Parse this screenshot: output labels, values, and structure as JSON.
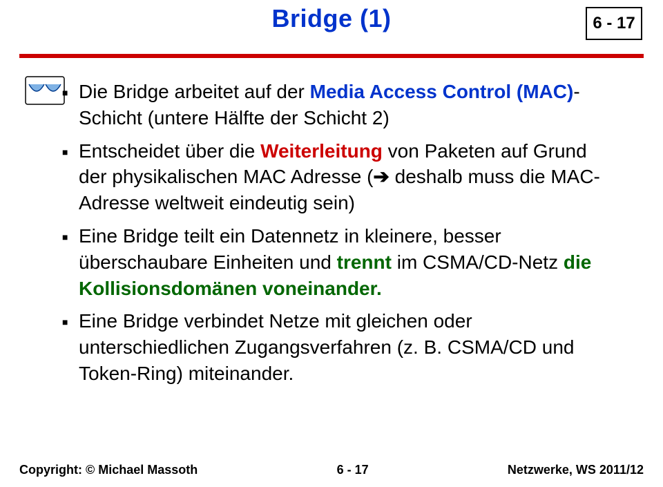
{
  "header": {
    "title": "Bridge (1)",
    "page_box": "6 - 17"
  },
  "bullets": {
    "b1": {
      "pre": "Die Bridge arbeitet auf der ",
      "em1": "Media Access Control (MAC)",
      "post1": "- Schicht (untere Hälfte der Schicht 2)"
    },
    "b2": {
      "pre": "Entscheidet über die ",
      "em1": "Weiterleitung",
      "mid": " von Paketen auf Grund der physikalischen MAC Adresse (",
      "arrow": "➔",
      "post": " deshalb muss die MAC-Adresse weltweit eindeutig sein)"
    },
    "b3": {
      "pre": "Eine Bridge teilt ein Datennetz in kleinere, besser überschaubare Einheiten und ",
      "em1": "trennt",
      "mid": " im CSMA/CD-Netz ",
      "em2": "die Kollisionsdomänen voneinander.",
      "post": ""
    },
    "b4": {
      "text": "Eine Bridge verbindet Netze mit gleichen oder unterschiedlichen Zugangsverfahren  (z. B. CSMA/CD und Token-Ring) miteinander."
    }
  },
  "footer": {
    "left": "Copyright: © Michael Massoth",
    "center": "6 - 17",
    "right": "Netzwerke, WS 2011/12"
  }
}
